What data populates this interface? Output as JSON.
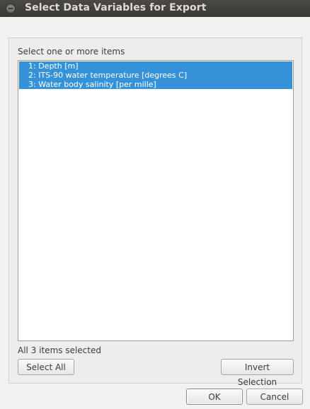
{
  "window": {
    "title": "Select Data Variables for Export"
  },
  "selector": {
    "instruction": "Select one or more items",
    "items": [
      {
        "label": "1: Depth [m]",
        "selected": true
      },
      {
        "label": "2: ITS-90 water temperature [degrees C]",
        "selected": true
      },
      {
        "label": "3: Water body salinity [per mille]",
        "selected": true
      }
    ],
    "status": "All 3 items selected",
    "select_all_label": "Select All",
    "invert_label": "Invert Selection"
  },
  "actions": {
    "ok_label": "OK",
    "cancel_label": "Cancel"
  },
  "colors": {
    "selection": "#3592d8",
    "titlebar": "#3c3b37"
  }
}
